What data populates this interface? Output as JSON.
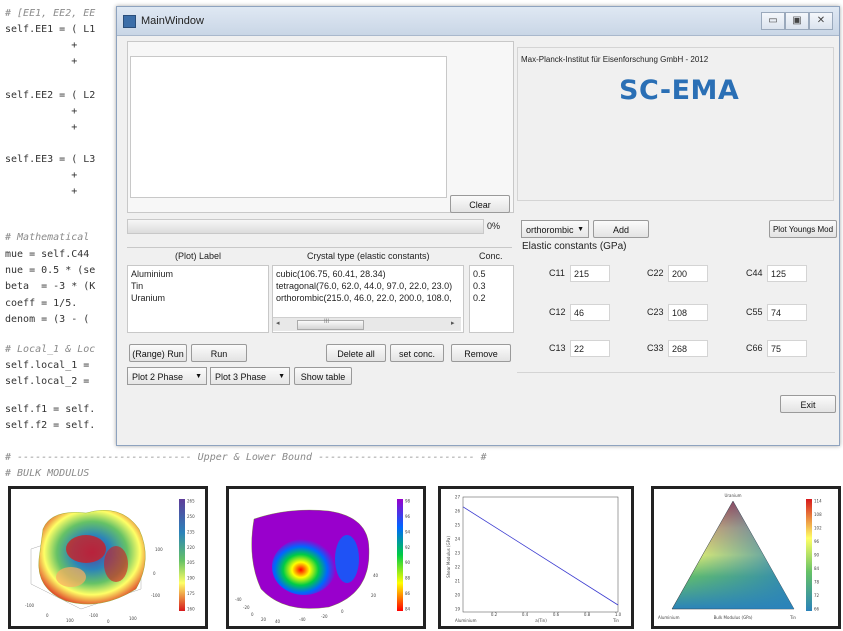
{
  "code_lines": [
    {
      "text": "# [EE1, EE2, EE",
      "comment": true
    },
    {
      "text": "self.EE1 = ( L1",
      "comment": false
    },
    {
      "text": "           +",
      "comment": false
    },
    {
      "text": "           +",
      "comment": false
    },
    {
      "text": "self.EE2 = ( L2",
      "comment": false
    },
    {
      "text": "           +",
      "comment": false
    },
    {
      "text": "           +",
      "comment": false
    },
    {
      "text": "self.EE3 = ( L3",
      "comment": false
    },
    {
      "text": "           +",
      "comment": false
    },
    {
      "text": "           +",
      "comment": false
    },
    {
      "text": "# Mathematical",
      "comment": true
    },
    {
      "text": "mue = self.C44",
      "comment": false
    },
    {
      "text": "nue = 0.5 * (se",
      "comment": false
    },
    {
      "text": "beta  = -3 * (K",
      "comment": false
    },
    {
      "text": "coeff = 1/5.",
      "comment": false
    },
    {
      "text": "denom = (3 - (",
      "comment": false
    },
    {
      "text": "# Local_1 & Loc",
      "comment": true
    },
    {
      "text": "self.local_1 =",
      "comment": false
    },
    {
      "text": "self.local_2 =",
      "comment": false
    },
    {
      "text": "self.f1 = self.",
      "comment": false
    },
    {
      "text": "self.f2 = self.",
      "comment": false
    }
  ],
  "section_lines": [
    "# ----------------------------- Upper & Lower Bound -------------------------- #",
    "# BULK MODULUS"
  ],
  "window": {
    "title": "MainWindow",
    "controls": {
      "minimize": "▭",
      "maximize": "▣",
      "close": "✕"
    }
  },
  "header": {
    "institute": "Max-Planck-Institut für Eisenforschung GmbH - 2012",
    "logo": "SC-EMA"
  },
  "clear_label": "Clear",
  "progress": {
    "text": "0%",
    "value": 0
  },
  "table": {
    "headers": {
      "label": "(Plot) Label",
      "crystal": "Crystal type (elastic constants)",
      "conc": "Conc."
    },
    "labels": [
      "Aluminium",
      "Tin",
      "Uranium"
    ],
    "crystals": [
      "cubic(106.75, 60.41, 28.34)",
      "tetragonal(76.0, 62.0, 44.0, 97.0, 22.0, 23.0)",
      "orthorombic(215.0, 46.0, 22.0, 200.0, 108.0,"
    ],
    "concs": [
      "0.5",
      "0.3",
      "0.2"
    ],
    "scroll_grip": "III"
  },
  "buttons": {
    "range_run": "(Range) Run",
    "run": "Run",
    "delete_all": "Delete all",
    "set_conc": "set conc.",
    "remove": "Remove",
    "show_table": "Show table",
    "add": "Add",
    "plot_youngs": "Plot Youngs Mod",
    "exit": "Exit"
  },
  "combos": {
    "plot2": "Plot 2 Phase",
    "plot3": "Plot 3 Phase",
    "crystal_system": "orthorombic"
  },
  "elastic": {
    "title": "Elastic constants (GPa)",
    "fields": [
      {
        "label": "C11",
        "value": "215"
      },
      {
        "label": "C22",
        "value": "200"
      },
      {
        "label": "C44",
        "value": "125"
      },
      {
        "label": "C12",
        "value": "46"
      },
      {
        "label": "C23",
        "value": "108"
      },
      {
        "label": "C55",
        "value": "74"
      },
      {
        "label": "C13",
        "value": "22"
      },
      {
        "label": "C33",
        "value": "268"
      },
      {
        "label": "C66",
        "value": "75"
      }
    ]
  },
  "colors": {
    "logo": "#2a6fb5",
    "titlebar_top": "#dfe8f3",
    "titlebar_bottom": "#c9d6e6",
    "window_bg": "#f0f0f0",
    "colormap": [
      "#d7191c",
      "#fdae61",
      "#ffff66",
      "#66c266",
      "#2b83ba",
      "#5e3c99"
    ],
    "purple_map": [
      "#ff0000",
      "#ff8800",
      "#ffff00",
      "#00cc44",
      "#0066ff",
      "#9900cc"
    ]
  },
  "thumbnails": {
    "surface1_colorbar": [
      "265",
      "250",
      "235",
      "220",
      "205",
      "190",
      "175",
      "160"
    ],
    "surface1_axes": [
      "-100",
      "0",
      "100",
      "-100",
      "0",
      "100",
      "-100",
      "0",
      "100"
    ],
    "surface2_colorbar": [
      "98",
      "96",
      "94",
      "92",
      "90",
      "88",
      "86",
      "84"
    ],
    "surface2_axes": [
      "-40",
      "-20",
      "0",
      "20",
      "40",
      "-40",
      "-20",
      "0",
      "20",
      "40"
    ],
    "line_chart": {
      "type": "line",
      "x": [
        0.0,
        1.0
      ],
      "y": [
        26.3,
        19.3
      ],
      "ylim": [
        18.8,
        27.0
      ],
      "yticks": [
        "27",
        "26",
        "25",
        "24",
        "23",
        "22",
        "21",
        "20",
        "19"
      ],
      "xticks": [
        "0.2",
        "0.4",
        "0.6",
        "0.8",
        "1.0"
      ],
      "ylabel": "Shear Modulus (GPa)",
      "xlabel": "a(Tin)",
      "x_left_label": "Aluminium",
      "x_right_label": "Tin"
    },
    "ternary": {
      "title": "Uranium",
      "bottom_left": "Aluminium",
      "bottom_right": "Tin",
      "axis_label": "Bulk Modulus (GPa)",
      "colorbar": [
        "114",
        "108",
        "102",
        "96",
        "90",
        "84",
        "78",
        "72",
        "66"
      ]
    }
  }
}
